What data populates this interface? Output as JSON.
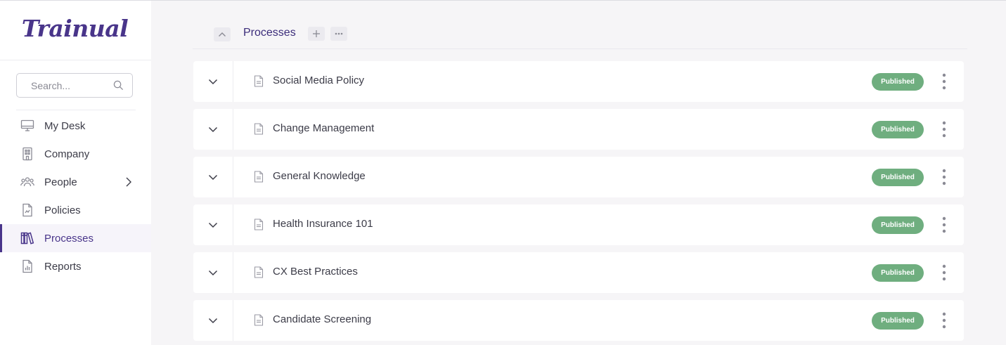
{
  "brand": {
    "logo_text": "Trainual",
    "accent": "#49358a",
    "badge_color": "#6fae7f"
  },
  "sidebar": {
    "search": {
      "placeholder": "Search..."
    },
    "items": [
      {
        "label": "My Desk",
        "icon": "monitor-icon",
        "active": false
      },
      {
        "label": "Company",
        "icon": "building-icon",
        "active": false
      },
      {
        "label": "People",
        "icon": "people-icon",
        "active": false,
        "has_chevron": true
      },
      {
        "label": "Policies",
        "icon": "policy-doc-icon",
        "active": false
      },
      {
        "label": "Processes",
        "icon": "books-icon",
        "active": true
      },
      {
        "label": "Reports",
        "icon": "report-icon",
        "active": false
      }
    ]
  },
  "main": {
    "section_title": "Processes",
    "rows": [
      {
        "title": "Social Media Policy",
        "status": "Published"
      },
      {
        "title": "Change Management",
        "status": "Published"
      },
      {
        "title": "General Knowledge",
        "status": "Published"
      },
      {
        "title": "Health Insurance 101",
        "status": "Published"
      },
      {
        "title": "CX Best Practices",
        "status": "Published"
      },
      {
        "title": "Candidate Screening",
        "status": "Published"
      }
    ]
  }
}
